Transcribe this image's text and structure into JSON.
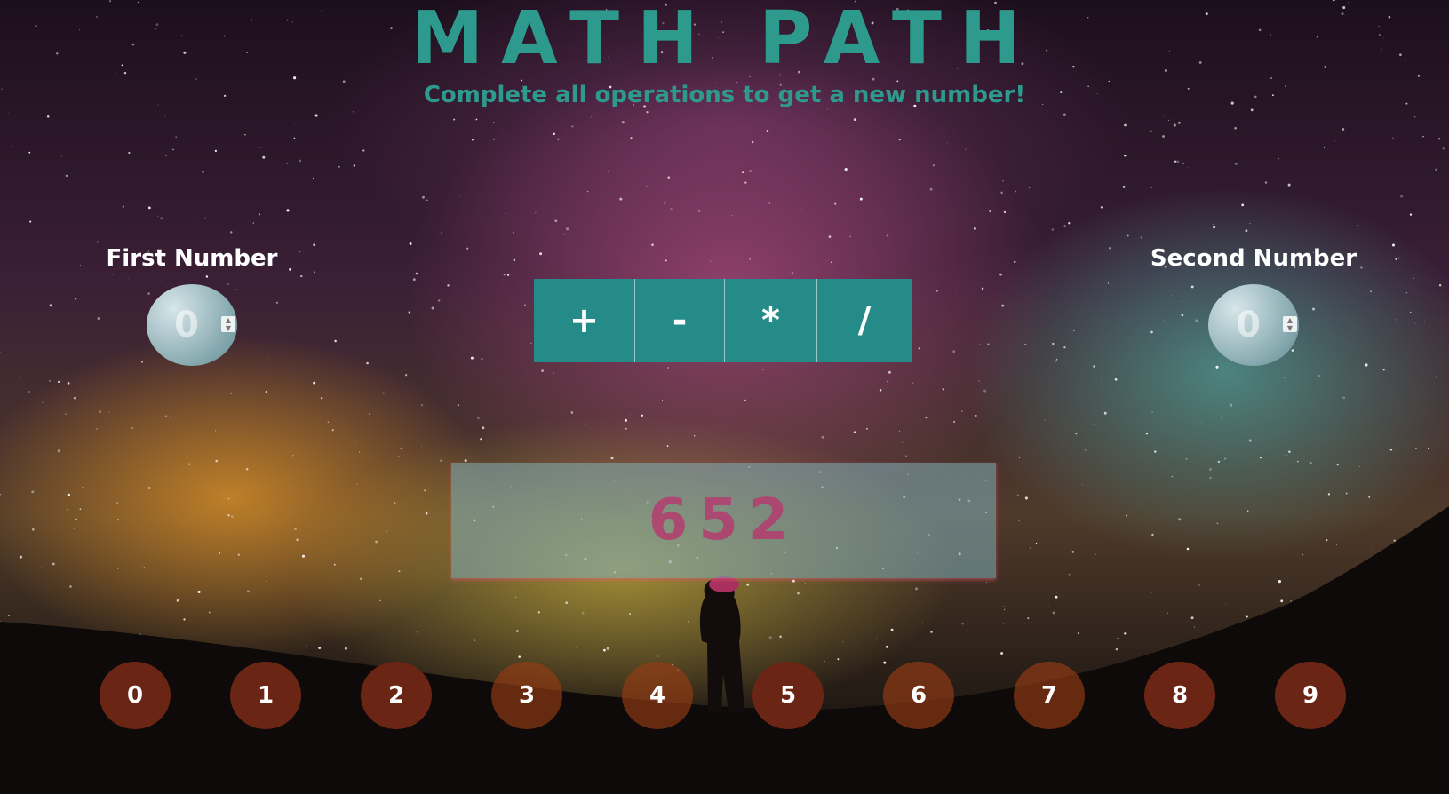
{
  "header": {
    "title": "MATH PATH",
    "subtitle": "Complete all operations to get a new number!"
  },
  "first_number": {
    "label": "First Number",
    "value": "0"
  },
  "second_number": {
    "label": "Second Number",
    "value": "0"
  },
  "operations": [
    "+",
    "-",
    "*",
    "/"
  ],
  "result": {
    "target": "652"
  },
  "digit_buttons": [
    "0",
    "1",
    "2",
    "3",
    "4",
    "5",
    "6",
    "7",
    "8",
    "9"
  ],
  "colors": {
    "accent": "#258b89",
    "title": "#2e9a8e",
    "digit_button": "#6b2515",
    "result_text": "#b43c6e"
  }
}
